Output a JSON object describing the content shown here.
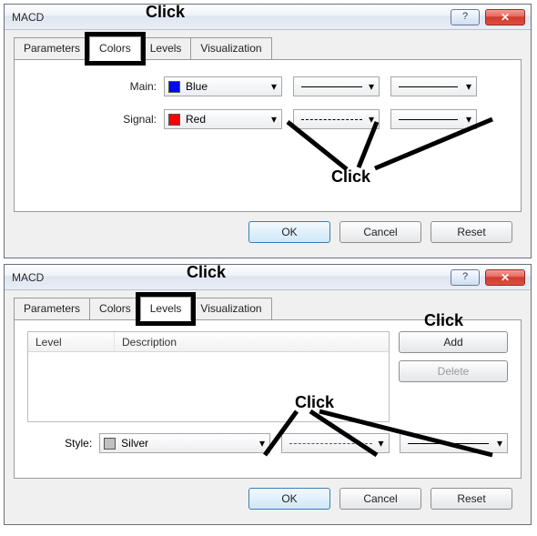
{
  "annotations": {
    "click": "Click"
  },
  "dialog1": {
    "title": "MACD",
    "help": "?",
    "close": "✕",
    "tabs": {
      "parameters": "Parameters",
      "colors": "Colors",
      "levels": "Levels",
      "visualization": "Visualization"
    },
    "rows": {
      "main": {
        "label": "Main:",
        "color_name": "Blue",
        "color_hex": "#0008ff"
      },
      "signal": {
        "label": "Signal:",
        "color_name": "Red",
        "color_hex": "#ff0000"
      }
    },
    "buttons": {
      "ok": "OK",
      "cancel": "Cancel",
      "reset": "Reset"
    }
  },
  "dialog2": {
    "title": "MACD",
    "help": "?",
    "close": "✕",
    "tabs": {
      "parameters": "Parameters",
      "colors": "Colors",
      "levels": "Levels",
      "visualization": "Visualization"
    },
    "list": {
      "col_level": "Level",
      "col_desc": "Description"
    },
    "side": {
      "add": "Add",
      "delete": "Delete"
    },
    "style": {
      "label": "Style:",
      "color_name": "Silver",
      "color_hex": "#c0c0c0"
    },
    "buttons": {
      "ok": "OK",
      "cancel": "Cancel",
      "reset": "Reset"
    }
  }
}
